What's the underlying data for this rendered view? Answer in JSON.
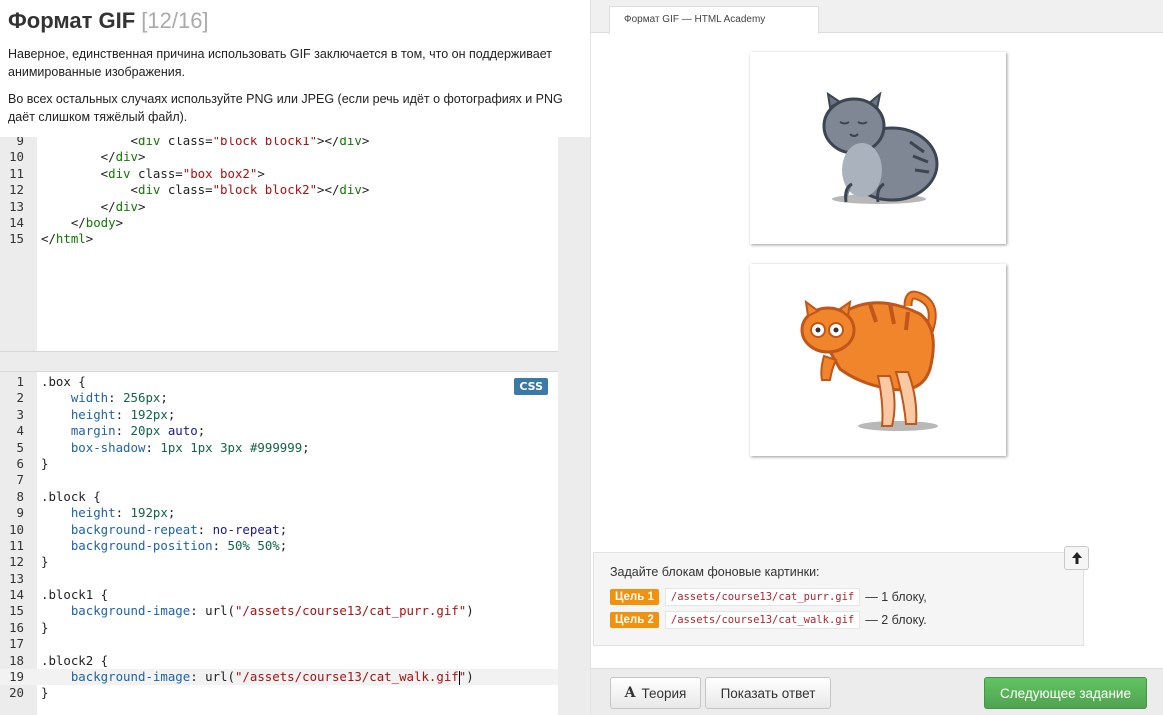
{
  "theory": {
    "title": "Формат GIF",
    "counter": "[12/16]",
    "paragraph1": "Наверное, единственная причина использовать GIF заключается в том, что он поддерживает анимированные изображения.",
    "paragraph2": "Во всех остальных случаях используйте PNG или JPEG (если речь идёт о фотографиях и PNG даёт слишком тяжёлый файл)."
  },
  "html_editor": {
    "lines": [
      {
        "n": "9",
        "text": "            <div class=\"block block1\"></div>"
      },
      {
        "n": "10",
        "text": "        </div>"
      },
      {
        "n": "11",
        "text": "        <div class=\"box box2\">"
      },
      {
        "n": "12",
        "text": "            <div class=\"block block2\"></div>"
      },
      {
        "n": "13",
        "text": "        </div>"
      },
      {
        "n": "14",
        "text": "    </body>"
      },
      {
        "n": "15",
        "text": "</html>"
      }
    ]
  },
  "css_editor": {
    "badge": "CSS",
    "lines": [
      {
        "n": "1",
        "text": ".box {"
      },
      {
        "n": "2",
        "text": "    width: 256px;"
      },
      {
        "n": "3",
        "text": "    height: 192px;"
      },
      {
        "n": "4",
        "text": "    margin: 20px auto;"
      },
      {
        "n": "5",
        "text": "    box-shadow: 1px 1px 3px #999999;"
      },
      {
        "n": "6",
        "text": "}"
      },
      {
        "n": "7",
        "text": ""
      },
      {
        "n": "8",
        "text": ".block {"
      },
      {
        "n": "9",
        "text": "    height: 192px;"
      },
      {
        "n": "10",
        "text": "    background-repeat: no-repeat;"
      },
      {
        "n": "11",
        "text": "    background-position: 50% 50%;"
      },
      {
        "n": "12",
        "text": "}"
      },
      {
        "n": "13",
        "text": ""
      },
      {
        "n": "14",
        "text": ".block1 {"
      },
      {
        "n": "15",
        "text": "    background-image: url(\"/assets/course13/cat_purr.gif\")"
      },
      {
        "n": "16",
        "text": "}"
      },
      {
        "n": "17",
        "text": ""
      },
      {
        "n": "18",
        "text": ".block2 {"
      },
      {
        "n": "19",
        "text": "    background-image: url(\"/assets/course13/cat_walk.gif\")"
      },
      {
        "n": "20",
        "text": "}"
      }
    ],
    "active_line": "19"
  },
  "preview": {
    "tab_title": "Формат GIF — HTML Academy"
  },
  "task": {
    "text": "Задайте блокам фоновые картинки:",
    "goals": [
      {
        "badge": "Цель 1",
        "path": "/assets/course13/cat_purr.gif",
        "suffix": "— 1 блоку,"
      },
      {
        "badge": "Цель 2",
        "path": "/assets/course13/cat_walk.gif",
        "suffix": "— 2 блоку."
      }
    ]
  },
  "buttons": {
    "theory": "Теория",
    "theory_icon": "A",
    "answer": "Показать ответ",
    "next": "Следующее задание"
  },
  "colors": {
    "goal_badge": "#f0920e",
    "next_button": "#5cb85c",
    "css_badge": "#3a7aa8"
  }
}
